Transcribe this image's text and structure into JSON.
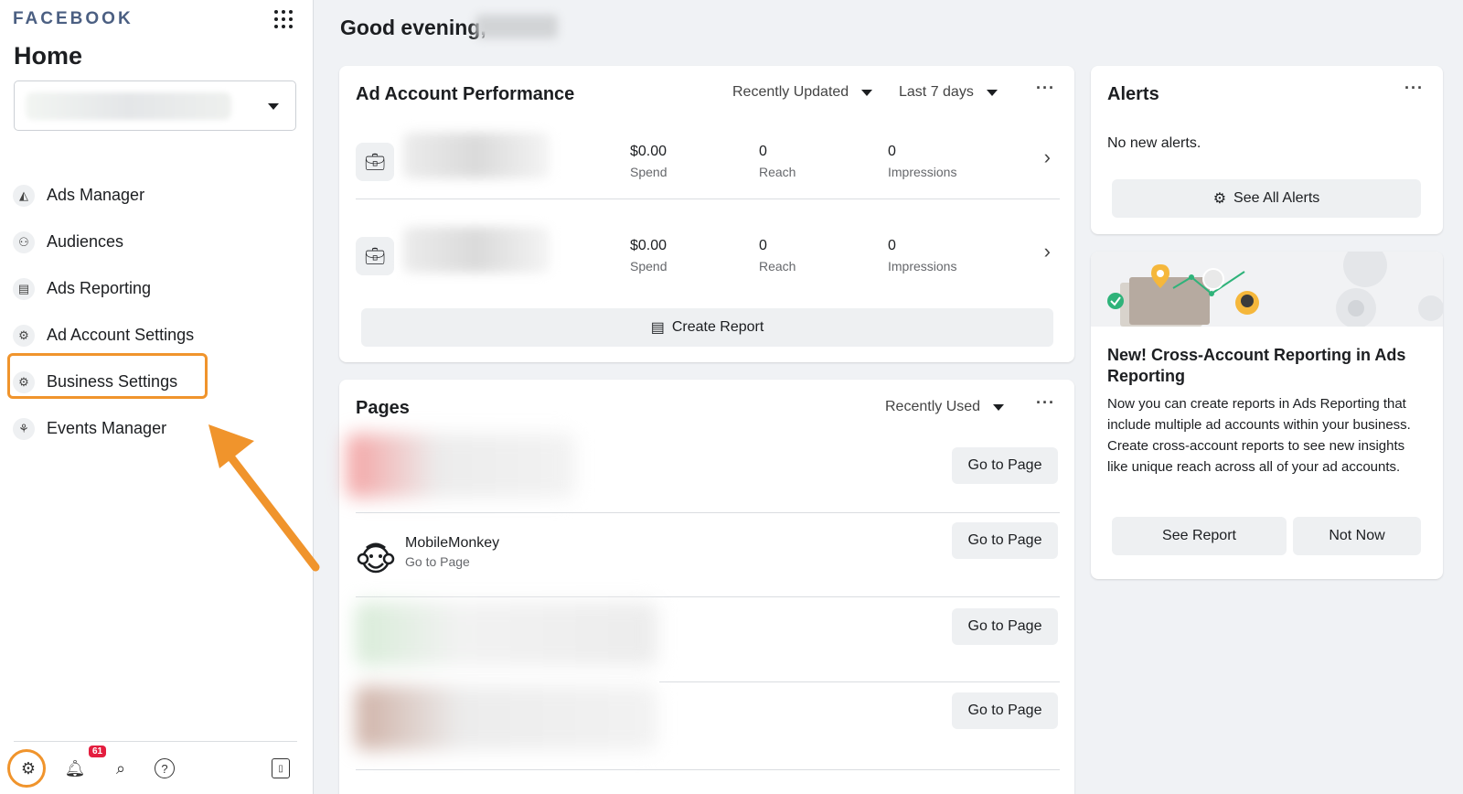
{
  "sidebar": {
    "brand": "FACEBOOK",
    "title": "Home",
    "items": [
      {
        "label": "Ads Manager",
        "icon": "ads-manager-icon",
        "glyph": "◭"
      },
      {
        "label": "Audiences",
        "icon": "audiences-icon",
        "glyph": "⚇"
      },
      {
        "label": "Ads Reporting",
        "icon": "ads-reporting-icon",
        "glyph": "▤"
      },
      {
        "label": "Ad Account Settings",
        "icon": "ad-account-settings-icon",
        "glyph": "⚙"
      },
      {
        "label": "Business Settings",
        "icon": "business-settings-icon",
        "glyph": "⚙"
      },
      {
        "label": "Events Manager",
        "icon": "events-manager-icon",
        "glyph": "⚘"
      }
    ],
    "notification_count": "61",
    "highlight_color": "#f0942c"
  },
  "main": {
    "greeting": "Good evening,",
    "ad_performance": {
      "title": "Ad Account Performance",
      "sort_label": "Recently Updated",
      "range_label": "Last 7 days",
      "rows": [
        {
          "spend": "$0.00",
          "spend_label": "Spend",
          "reach": "0",
          "reach_label": "Reach",
          "impressions": "0",
          "impressions_label": "Impressions"
        },
        {
          "spend": "$0.00",
          "spend_label": "Spend",
          "reach": "0",
          "reach_label": "Reach",
          "impressions": "0",
          "impressions_label": "Impressions"
        }
      ],
      "create_report_label": "Create Report"
    },
    "pages": {
      "title": "Pages",
      "sort_label": "Recently Used",
      "rows": [
        {
          "name": "",
          "sub": "",
          "button": "Go to Page",
          "blur_color": "#f4a3a3"
        },
        {
          "name": "MobileMonkey",
          "sub": "Go to Page",
          "button": "Go to Page"
        },
        {
          "name": "",
          "sub": "",
          "button": "Go to Page",
          "blur_color": "#d8ecd8"
        },
        {
          "name": "",
          "sub": "",
          "button": "Go to Page",
          "blur_color": "#cfb1a6"
        }
      ]
    }
  },
  "alerts": {
    "title": "Alerts",
    "empty_text": "No new alerts.",
    "see_all_label": "See All Alerts"
  },
  "promo": {
    "headline": "New! Cross-Account Reporting in Ads Reporting",
    "body": "Now you can create reports in Ads Reporting that include multiple ad accounts within your business. Create cross-account reports to see new insights like unique reach across all of your ad accounts.",
    "primary_label": "See Report",
    "secondary_label": "Not Now"
  }
}
